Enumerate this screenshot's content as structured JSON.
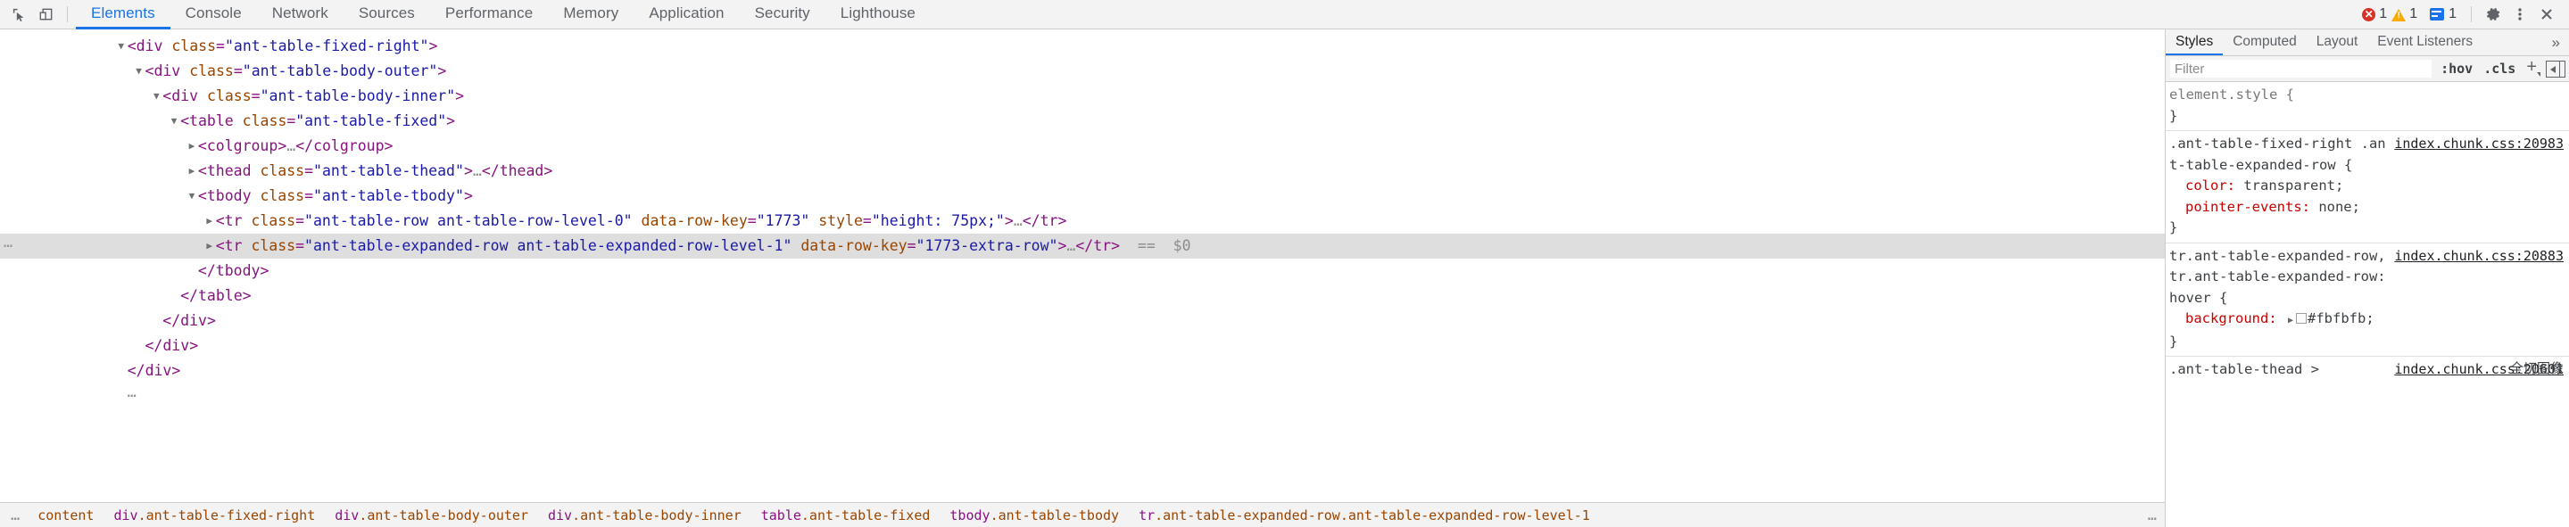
{
  "toolbar": {
    "inspect_icon": "inspect-element-icon",
    "device_icon": "device-toolbar-icon",
    "tabs": [
      {
        "label": "Elements",
        "selected": true
      },
      {
        "label": "Console",
        "selected": false
      },
      {
        "label": "Network",
        "selected": false
      },
      {
        "label": "Sources",
        "selected": false
      },
      {
        "label": "Performance",
        "selected": false
      },
      {
        "label": "Memory",
        "selected": false
      },
      {
        "label": "Application",
        "selected": false
      },
      {
        "label": "Security",
        "selected": false
      },
      {
        "label": "Lighthouse",
        "selected": false
      }
    ],
    "errors": {
      "icon": "error-circle-icon",
      "count": "1",
      "color": "#d93025"
    },
    "warnings": {
      "icon": "warning-triangle-icon",
      "count": "1",
      "color": "#f9ab00"
    },
    "messages": {
      "icon": "info-message-icon",
      "count": "1",
      "color": "#1a73e8"
    },
    "settings_icon": "gear-icon",
    "more_icon": "kebab-menu-icon",
    "close_icon": "close-icon"
  },
  "dom_tree": {
    "lines": [
      {
        "indent": 13,
        "twisty": "▼",
        "parts": [
          {
            "t": "punct",
            "v": "<"
          },
          {
            "t": "tag",
            "v": "div"
          },
          {
            "t": "plain",
            "v": " "
          },
          {
            "t": "attr-name",
            "v": "class"
          },
          {
            "t": "attr-eq",
            "v": "="
          },
          {
            "t": "attr-val",
            "v": "\"ant-table-fixed-right\""
          },
          {
            "t": "punct",
            "v": ">"
          }
        ]
      },
      {
        "indent": 15,
        "twisty": "▼",
        "parts": [
          {
            "t": "punct",
            "v": "<"
          },
          {
            "t": "tag",
            "v": "div"
          },
          {
            "t": "plain",
            "v": " "
          },
          {
            "t": "attr-name",
            "v": "class"
          },
          {
            "t": "attr-eq",
            "v": "="
          },
          {
            "t": "attr-val",
            "v": "\"ant-table-body-outer\""
          },
          {
            "t": "punct",
            "v": ">"
          }
        ]
      },
      {
        "indent": 17,
        "twisty": "▼",
        "parts": [
          {
            "t": "punct",
            "v": "<"
          },
          {
            "t": "tag",
            "v": "div"
          },
          {
            "t": "plain",
            "v": " "
          },
          {
            "t": "attr-name",
            "v": "class"
          },
          {
            "t": "attr-eq",
            "v": "="
          },
          {
            "t": "attr-val",
            "v": "\"ant-table-body-inner\""
          },
          {
            "t": "punct",
            "v": ">"
          }
        ]
      },
      {
        "indent": 19,
        "twisty": "▼",
        "parts": [
          {
            "t": "punct",
            "v": "<"
          },
          {
            "t": "tag",
            "v": "table"
          },
          {
            "t": "plain",
            "v": " "
          },
          {
            "t": "attr-name",
            "v": "class"
          },
          {
            "t": "attr-eq",
            "v": "="
          },
          {
            "t": "attr-val",
            "v": "\"ant-table-fixed\""
          },
          {
            "t": "punct",
            "v": ">"
          }
        ]
      },
      {
        "indent": 21,
        "twisty": "▶",
        "parts": [
          {
            "t": "punct",
            "v": "<"
          },
          {
            "t": "tag",
            "v": "colgroup"
          },
          {
            "t": "punct",
            "v": ">"
          },
          {
            "t": "ellip",
            "v": "…"
          },
          {
            "t": "punct",
            "v": "</"
          },
          {
            "t": "tag",
            "v": "colgroup"
          },
          {
            "t": "punct",
            "v": ">"
          }
        ]
      },
      {
        "indent": 21,
        "twisty": "▶",
        "parts": [
          {
            "t": "punct",
            "v": "<"
          },
          {
            "t": "tag",
            "v": "thead"
          },
          {
            "t": "plain",
            "v": " "
          },
          {
            "t": "attr-name",
            "v": "class"
          },
          {
            "t": "attr-eq",
            "v": "="
          },
          {
            "t": "attr-val",
            "v": "\"ant-table-thead\""
          },
          {
            "t": "punct",
            "v": ">"
          },
          {
            "t": "ellip",
            "v": "…"
          },
          {
            "t": "punct",
            "v": "</"
          },
          {
            "t": "tag",
            "v": "thead"
          },
          {
            "t": "punct",
            "v": ">"
          }
        ]
      },
      {
        "indent": 21,
        "twisty": "▼",
        "parts": [
          {
            "t": "punct",
            "v": "<"
          },
          {
            "t": "tag",
            "v": "tbody"
          },
          {
            "t": "plain",
            "v": " "
          },
          {
            "t": "attr-name",
            "v": "class"
          },
          {
            "t": "attr-eq",
            "v": "="
          },
          {
            "t": "attr-val",
            "v": "\"ant-table-tbody\""
          },
          {
            "t": "punct",
            "v": ">"
          }
        ]
      },
      {
        "indent": 23,
        "twisty": "▶",
        "parts": [
          {
            "t": "punct",
            "v": "<"
          },
          {
            "t": "tag",
            "v": "tr"
          },
          {
            "t": "plain",
            "v": " "
          },
          {
            "t": "attr-name",
            "v": "class"
          },
          {
            "t": "attr-eq",
            "v": "="
          },
          {
            "t": "attr-val",
            "v": "\"ant-table-row ant-table-row-level-0\""
          },
          {
            "t": "plain",
            "v": " "
          },
          {
            "t": "attr-name",
            "v": "data-row-key"
          },
          {
            "t": "attr-eq",
            "v": "="
          },
          {
            "t": "attr-val",
            "v": "\"1773\""
          },
          {
            "t": "plain",
            "v": " "
          },
          {
            "t": "attr-name",
            "v": "style"
          },
          {
            "t": "attr-eq",
            "v": "="
          },
          {
            "t": "attr-val",
            "v": "\"height: 75px;\""
          },
          {
            "t": "punct",
            "v": ">"
          },
          {
            "t": "ellip",
            "v": "…"
          },
          {
            "t": "punct",
            "v": "</"
          },
          {
            "t": "tag",
            "v": "tr"
          },
          {
            "t": "punct",
            "v": ">"
          }
        ]
      },
      {
        "indent": 23,
        "twisty": "▶",
        "selected": true,
        "gutter": "⋯",
        "parts": [
          {
            "t": "punct",
            "v": "<"
          },
          {
            "t": "tag",
            "v": "tr"
          },
          {
            "t": "plain",
            "v": " "
          },
          {
            "t": "attr-name",
            "v": "class"
          },
          {
            "t": "attr-eq",
            "v": "="
          },
          {
            "t": "attr-val",
            "v": "\"ant-table-expanded-row ant-table-expanded-row-level-1\""
          },
          {
            "t": "plain",
            "v": " "
          },
          {
            "t": "attr-name",
            "v": "data-row-key"
          },
          {
            "t": "attr-eq",
            "v": "="
          },
          {
            "t": "attr-val",
            "v": "\"1773-extra-row\""
          },
          {
            "t": "punct",
            "v": ">"
          },
          {
            "t": "ellip",
            "v": "…"
          },
          {
            "t": "punct",
            "v": "</"
          },
          {
            "t": "tag",
            "v": "tr"
          },
          {
            "t": "punct",
            "v": ">"
          },
          {
            "t": "marker",
            "v": "  ==  $0"
          }
        ]
      },
      {
        "indent": 21,
        "twisty": "",
        "parts": [
          {
            "t": "punct",
            "v": "</"
          },
          {
            "t": "tag",
            "v": "tbody"
          },
          {
            "t": "punct",
            "v": ">"
          }
        ]
      },
      {
        "indent": 19,
        "twisty": "",
        "parts": [
          {
            "t": "punct",
            "v": "</"
          },
          {
            "t": "tag",
            "v": "table"
          },
          {
            "t": "punct",
            "v": ">"
          }
        ]
      },
      {
        "indent": 17,
        "twisty": "",
        "parts": [
          {
            "t": "punct",
            "v": "</"
          },
          {
            "t": "tag",
            "v": "div"
          },
          {
            "t": "punct",
            "v": ">"
          }
        ]
      },
      {
        "indent": 15,
        "twisty": "",
        "parts": [
          {
            "t": "punct",
            "v": "</"
          },
          {
            "t": "tag",
            "v": "div"
          },
          {
            "t": "punct",
            "v": ">"
          }
        ]
      },
      {
        "indent": 13,
        "twisty": "",
        "parts": [
          {
            "t": "punct",
            "v": "</"
          },
          {
            "t": "tag",
            "v": "div"
          },
          {
            "t": "punct",
            "v": ">"
          }
        ]
      },
      {
        "indent": 13,
        "twisty": "",
        "parts": [
          {
            "t": "ellip",
            "v": "⋯"
          }
        ]
      }
    ]
  },
  "breadcrumb": {
    "leading_ellipsis": "…",
    "trailing_ellipsis": "…",
    "items": [
      {
        "tag": "",
        "cls": "content"
      },
      {
        "tag": "div",
        "cls": ".ant-table-fixed-right"
      },
      {
        "tag": "div",
        "cls": ".ant-table-body-outer"
      },
      {
        "tag": "div",
        "cls": ".ant-table-body-inner"
      },
      {
        "tag": "table",
        "cls": ".ant-table-fixed"
      },
      {
        "tag": "tbody",
        "cls": ".ant-table-tbody"
      },
      {
        "tag": "tr",
        "cls": ".ant-table-expanded-row.ant-table-expanded-row-level-1"
      }
    ]
  },
  "styles_sidebar": {
    "tabs": [
      {
        "label": "Styles",
        "selected": true
      },
      {
        "label": "Computed",
        "selected": false
      },
      {
        "label": "Layout",
        "selected": false
      },
      {
        "label": "Event Listeners",
        "selected": false
      }
    ],
    "more_tabs_icon": "chevron-double-right-icon",
    "filter": {
      "value": "",
      "placeholder": "Filter"
    },
    "toggles": [
      ":hov",
      ".cls"
    ],
    "new_rule_icon": "plus-icon",
    "panel_toggle_icon": "toggle-sidebar-icon",
    "rules": [
      {
        "selector": "element.style {",
        "origin": "",
        "declarations": [],
        "close": "}"
      },
      {
        "selector": ".ant-table-fixed-right .ant-table-expanded-row {",
        "origin": "index.chunk.css:20983",
        "declarations": [
          {
            "prop": "color",
            "value": "transparent;"
          },
          {
            "prop": "pointer-events",
            "value": "none;",
            "prop_color": "#c80000"
          }
        ],
        "close": "}"
      },
      {
        "selector": "tr.ant-table-expanded-row, tr.ant-table-expanded-row:hover {",
        "origin": "index.chunk.css:20883",
        "declarations": [
          {
            "prop": "background",
            "value": "#fbfbfb;",
            "swatch": "#fbfbfb",
            "has_arrow": true
          }
        ],
        "close": "}"
      },
      {
        "selector": ".ant-table-thead > ",
        "origin": "index.chunk.css:20601",
        "declarations": [],
        "close": ""
      }
    ],
    "overlap_text": "全切图像"
  },
  "colors": {
    "accent": "#1a73e8",
    "toolbar_bg": "#f3f3f3",
    "selected_row": "#dedede",
    "tag": "#881280",
    "attr_name": "#994500",
    "attr_value": "#1a1aa6",
    "css_prop": "#c80000"
  }
}
